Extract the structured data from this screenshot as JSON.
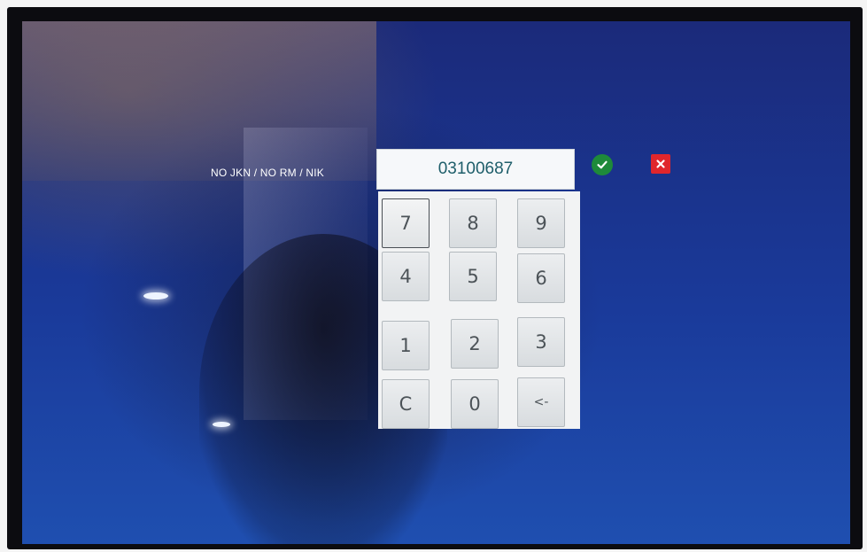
{
  "prompt": {
    "label": "NO JKN / NO RM / NIK"
  },
  "input": {
    "value": "03100687"
  },
  "actions": {
    "confirm_icon": "check-icon",
    "cancel_icon": "close-icon",
    "confirm_color": "#1e8a3a",
    "cancel_color": "#e0262c"
  },
  "keypad": {
    "keys": [
      "7",
      "8",
      "9",
      "4",
      "5",
      "6",
      "1",
      "2",
      "3",
      "C",
      "0",
      "<-"
    ]
  }
}
